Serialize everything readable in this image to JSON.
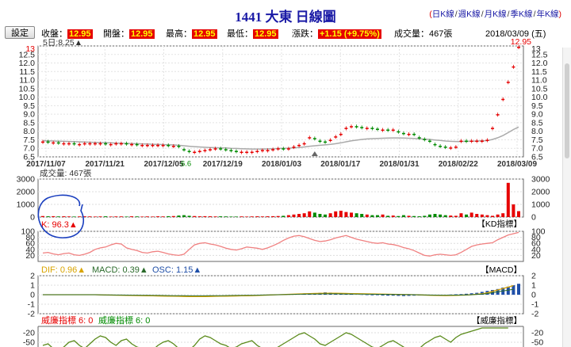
{
  "title": "1441 大東  日線圖",
  "links": {
    "open": "(",
    "close": ")",
    "items": [
      "日K線",
      "週K線",
      "月K線",
      "季K線",
      "年K線"
    ]
  },
  "toolbar": {
    "setting_label": "設定"
  },
  "quote": {
    "close_label": "收盤：",
    "close": "12.95",
    "open_label": "開盤：",
    "open": "12.95",
    "high_label": "最高：",
    "high": "12.95",
    "low_label": "最低：",
    "low": "12.95",
    "change_label": "漲跌：",
    "change": "+1.15 (+9.75%)",
    "volume_label": "成交量：",
    "volume": "467張",
    "date": "2018/03/09 (五)"
  },
  "ma_label": "5日:8.25▲",
  "price_marker_top": "12.95",
  "price_marker_left": "13",
  "low_marker": "6.6",
  "volume_label": "成交量: 467張",
  "kd": {
    "label": "K: 96.3▲",
    "tab": "【KD指標】"
  },
  "macd": {
    "dif": "DIF: 0.96▲",
    "macd": "MACD: 0.39▲",
    "osc": "OSC: 1.15▲",
    "tab": "【MACD】"
  },
  "wei": {
    "a": "威廉指標 6: 0",
    "b": "威廉指標 6: 0",
    "tab": "【威廉指標】"
  },
  "colors": {
    "up": "#e60000",
    "down": "#008a00",
    "ma": "#aaaaaa",
    "kd": "#f08080",
    "dif": "#d9a400",
    "macd": "#2a6a2a",
    "osc": "#1f4fa8",
    "accent": "#1a1aa6",
    "wr": "#5a8a1a"
  },
  "chart_data": {
    "type": "candlestick",
    "x_ticks": [
      "2017/11/07",
      "2017/11/21",
      "2017/12/05",
      "2017/12/19",
      "2018/01/03",
      "2018/01/17",
      "2018/01/31",
      "2018/02/22",
      "2018/03/09"
    ],
    "price_axis": [
      "13",
      "12.5",
      "12.0",
      "11.5",
      "11.0",
      "10.5",
      "10.0",
      "9.5",
      "9.0",
      "8.5",
      "8.0",
      "7.5",
      "7.0",
      "6.5"
    ],
    "price_ylim": [
      6.5,
      13
    ],
    "volume_axis": [
      "3000",
      "2000",
      "1000",
      "0"
    ],
    "volume_ylim": [
      0,
      3000
    ],
    "kd_axis": [
      "100",
      "80",
      "60",
      "40",
      "20"
    ],
    "kd_ylim": [
      0,
      100
    ],
    "macd_axis": [
      "2",
      "1",
      "0",
      "-1",
      "-2"
    ],
    "macd_ylim": [
      -2,
      2
    ],
    "wr_axis": [
      "-20",
      "-50",
      "-80"
    ],
    "wr_ylim": [
      -100,
      0
    ],
    "close": [
      7.4,
      7.35,
      7.35,
      7.3,
      7.3,
      7.3,
      7.25,
      7.25,
      7.3,
      7.3,
      7.3,
      7.3,
      7.25,
      7.25,
      7.3,
      7.3,
      7.25,
      7.25,
      7.2,
      7.2,
      7.2,
      7.2,
      7.2,
      7.2,
      7.15,
      7.15,
      7.1,
      6.9,
      6.8,
      6.8,
      6.85,
      6.9,
      6.95,
      7.0,
      6.95,
      6.9,
      6.85,
      6.8,
      6.8,
      6.8,
      6.8,
      6.85,
      6.9,
      6.9,
      6.95,
      7.0,
      6.95,
      7.0,
      7.1,
      7.2,
      7.3,
      7.65,
      7.55,
      7.4,
      7.35,
      7.5,
      7.7,
      7.85,
      8.2,
      8.3,
      8.25,
      8.2,
      8.2,
      8.15,
      8.1,
      8.1,
      8.05,
      8.1,
      7.95,
      7.85,
      7.85,
      7.8,
      7.6,
      7.5,
      7.4,
      7.2,
      7.1,
      7.05,
      7.05,
      7.1,
      7.45,
      7.4,
      7.45,
      7.45,
      7.45,
      7.5,
      8.2,
      9.0,
      9.9,
      10.9,
      11.8,
      12.95
    ],
    "volume": [
      80,
      60,
      70,
      50,
      60,
      50,
      40,
      50,
      60,
      50,
      40,
      50,
      60,
      40,
      50,
      50,
      40,
      60,
      50,
      40,
      50,
      40,
      60,
      50,
      70,
      80,
      120,
      150,
      100,
      80,
      60,
      70,
      60,
      50,
      60,
      50,
      40,
      40,
      50,
      40,
      50,
      60,
      50,
      60,
      70,
      80,
      100,
      150,
      200,
      250,
      300,
      450,
      350,
      250,
      200,
      300,
      450,
      500,
      400,
      350,
      300,
      250,
      200,
      150,
      150,
      200,
      100,
      120,
      80,
      150,
      100,
      80,
      60,
      100,
      200,
      250,
      200,
      150,
      120,
      100,
      300,
      200,
      350,
      250,
      200,
      150,
      100,
      200,
      300,
      2700,
      1000,
      467
    ],
    "ma": [
      7.45,
      7.44,
      7.43,
      7.42,
      7.41,
      7.4,
      7.39,
      7.38,
      7.37,
      7.36,
      7.35,
      7.34,
      7.33,
      7.32,
      7.31,
      7.3,
      7.29,
      7.28,
      7.27,
      7.26,
      7.25,
      7.24,
      7.23,
      7.22,
      7.21,
      7.2,
      7.18,
      7.15,
      7.12,
      7.1,
      7.08,
      7.06,
      7.05,
      7.04,
      7.03,
      7.02,
      7.0,
      6.99,
      6.98,
      6.97,
      6.96,
      6.96,
      6.96,
      6.97,
      6.98,
      6.99,
      7.0,
      7.01,
      7.03,
      7.05,
      7.08,
      7.12,
      7.15,
      7.18,
      7.2,
      7.23,
      7.27,
      7.32,
      7.38,
      7.44,
      7.48,
      7.52,
      7.55,
      7.57,
      7.58,
      7.59,
      7.6,
      7.61,
      7.61,
      7.6,
      7.59,
      7.58,
      7.56,
      7.54,
      7.52,
      7.49,
      7.46,
      7.43,
      7.41,
      7.4,
      7.4,
      7.41,
      7.42,
      7.43,
      7.44,
      7.45,
      7.52,
      7.62,
      7.75,
      7.92,
      8.1,
      8.25
    ],
    "kd": [
      28,
      30,
      25,
      22,
      26,
      28,
      22,
      20,
      24,
      30,
      40,
      45,
      48,
      55,
      60,
      58,
      45,
      40,
      36,
      30,
      28,
      32,
      34,
      30,
      25,
      22,
      20,
      24,
      40,
      55,
      60,
      62,
      58,
      55,
      50,
      44,
      40,
      38,
      42,
      48,
      46,
      44,
      40,
      45,
      52,
      60,
      70,
      78,
      84,
      86,
      82,
      76,
      70,
      66,
      68,
      72,
      78,
      82,
      86,
      80,
      74,
      70,
      66,
      62,
      60,
      62,
      58,
      56,
      52,
      46,
      42,
      36,
      28,
      20,
      18,
      22,
      24,
      22,
      20,
      22,
      30,
      40,
      50,
      55,
      58,
      60,
      62,
      72,
      80,
      88,
      92,
      96.3
    ],
    "dif": [
      0,
      0,
      0,
      0,
      0,
      0,
      0,
      0,
      0,
      0,
      0,
      -0.02,
      -0.03,
      -0.04,
      -0.05,
      -0.06,
      -0.07,
      -0.08,
      -0.09,
      -0.1,
      -0.11,
      -0.12,
      -0.13,
      -0.14,
      -0.15,
      -0.16,
      -0.17,
      -0.18,
      -0.19,
      -0.2,
      -0.2,
      -0.19,
      -0.18,
      -0.17,
      -0.16,
      -0.15,
      -0.14,
      -0.13,
      -0.12,
      -0.11,
      -0.1,
      -0.08,
      -0.06,
      -0.04,
      -0.02,
      0,
      0.02,
      0.04,
      0.06,
      0.08,
      0.1,
      0.12,
      0.13,
      0.14,
      0.15,
      0.15,
      0.15,
      0.14,
      0.13,
      0.12,
      0.11,
      0.1,
      0.09,
      0.08,
      0.07,
      0.06,
      0.05,
      0.04,
      0.03,
      0.02,
      0.01,
      0,
      -0.02,
      -0.04,
      -0.06,
      -0.07,
      -0.08,
      -0.09,
      -0.08,
      -0.07,
      -0.05,
      -0.03,
      0,
      0.05,
      0.1,
      0.2,
      0.35,
      0.5,
      0.65,
      0.8,
      0.96
    ],
    "osc": [
      0,
      0,
      0,
      0,
      0,
      0,
      0,
      0,
      0,
      0,
      0,
      0,
      0,
      0,
      0,
      0,
      0,
      0,
      0,
      0,
      0,
      0,
      0,
      0,
      0,
      0,
      0,
      0,
      0,
      0,
      0,
      0,
      0,
      0,
      0,
      0,
      0,
      0,
      0,
      0,
      0,
      0,
      0,
      0,
      0,
      0,
      0,
      0,
      0,
      0,
      0.05,
      0.1,
      0.15,
      0.2,
      0.25,
      0.22,
      0.2,
      0.15,
      0.1,
      0.05,
      0,
      -0.02,
      -0.04,
      -0.06,
      -0.05,
      -0.08,
      -0.1,
      -0.1,
      -0.12,
      -0.14,
      -0.12,
      -0.1,
      -0.08,
      -0.06,
      -0.04,
      -0.03,
      -0.02,
      0,
      0.02,
      0.04,
      0.06,
      0.1,
      0.15,
      0.2,
      0.3,
      0.4,
      0.5,
      0.6,
      0.75,
      0.85,
      1.0,
      1.15
    ],
    "wr": [
      -60,
      -55,
      -70,
      -75,
      -65,
      -50,
      -45,
      -60,
      -70,
      -55,
      -40,
      -30,
      -35,
      -50,
      -60,
      -45,
      -40,
      -55,
      -65,
      -70,
      -80,
      -75,
      -60,
      -50,
      -45,
      -55,
      -70,
      -85,
      -75,
      -60,
      -40,
      -30,
      -35,
      -45,
      -55,
      -60,
      -70,
      -65,
      -55,
      -50,
      -45,
      -60,
      -70,
      -80,
      -75,
      -65,
      -55,
      -45,
      -35,
      -25,
      -20,
      -30,
      -40,
      -55,
      -60,
      -50,
      -40,
      -30,
      -20,
      -25,
      -35,
      -45,
      -55,
      -65,
      -70,
      -60,
      -50,
      -45,
      -55,
      -65,
      -75,
      -80,
      -70,
      -55,
      -45,
      -35,
      -30,
      -40,
      -50,
      -35,
      -25,
      -20,
      -15,
      -10,
      -5,
      -5,
      -5,
      -5,
      -5,
      -5
    ]
  }
}
